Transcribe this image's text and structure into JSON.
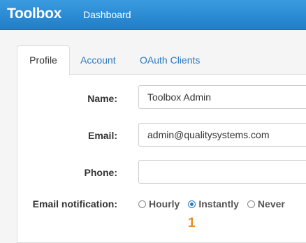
{
  "header": {
    "brand": "Toolbox",
    "nav": [
      "Dashboard"
    ]
  },
  "tabs": [
    {
      "label": "Profile",
      "active": true
    },
    {
      "label": "Account",
      "active": false
    },
    {
      "label": "OAuth Clients",
      "active": false
    }
  ],
  "form": {
    "name_label": "Name:",
    "name_value": "Toolbox Admin",
    "email_label": "Email:",
    "email_value": "admin@qualitysystems.com",
    "phone_label": "Phone:",
    "phone_value": "",
    "notification_label": "Email notification:",
    "notification_options": [
      "Hourly",
      "Instantly",
      "Never"
    ],
    "notification_selected": "Instantly"
  },
  "annotation_marker": "1",
  "colors": {
    "header_bg": "#2a8ad6",
    "link": "#2a7ac4",
    "marker": "#f08a1c"
  }
}
